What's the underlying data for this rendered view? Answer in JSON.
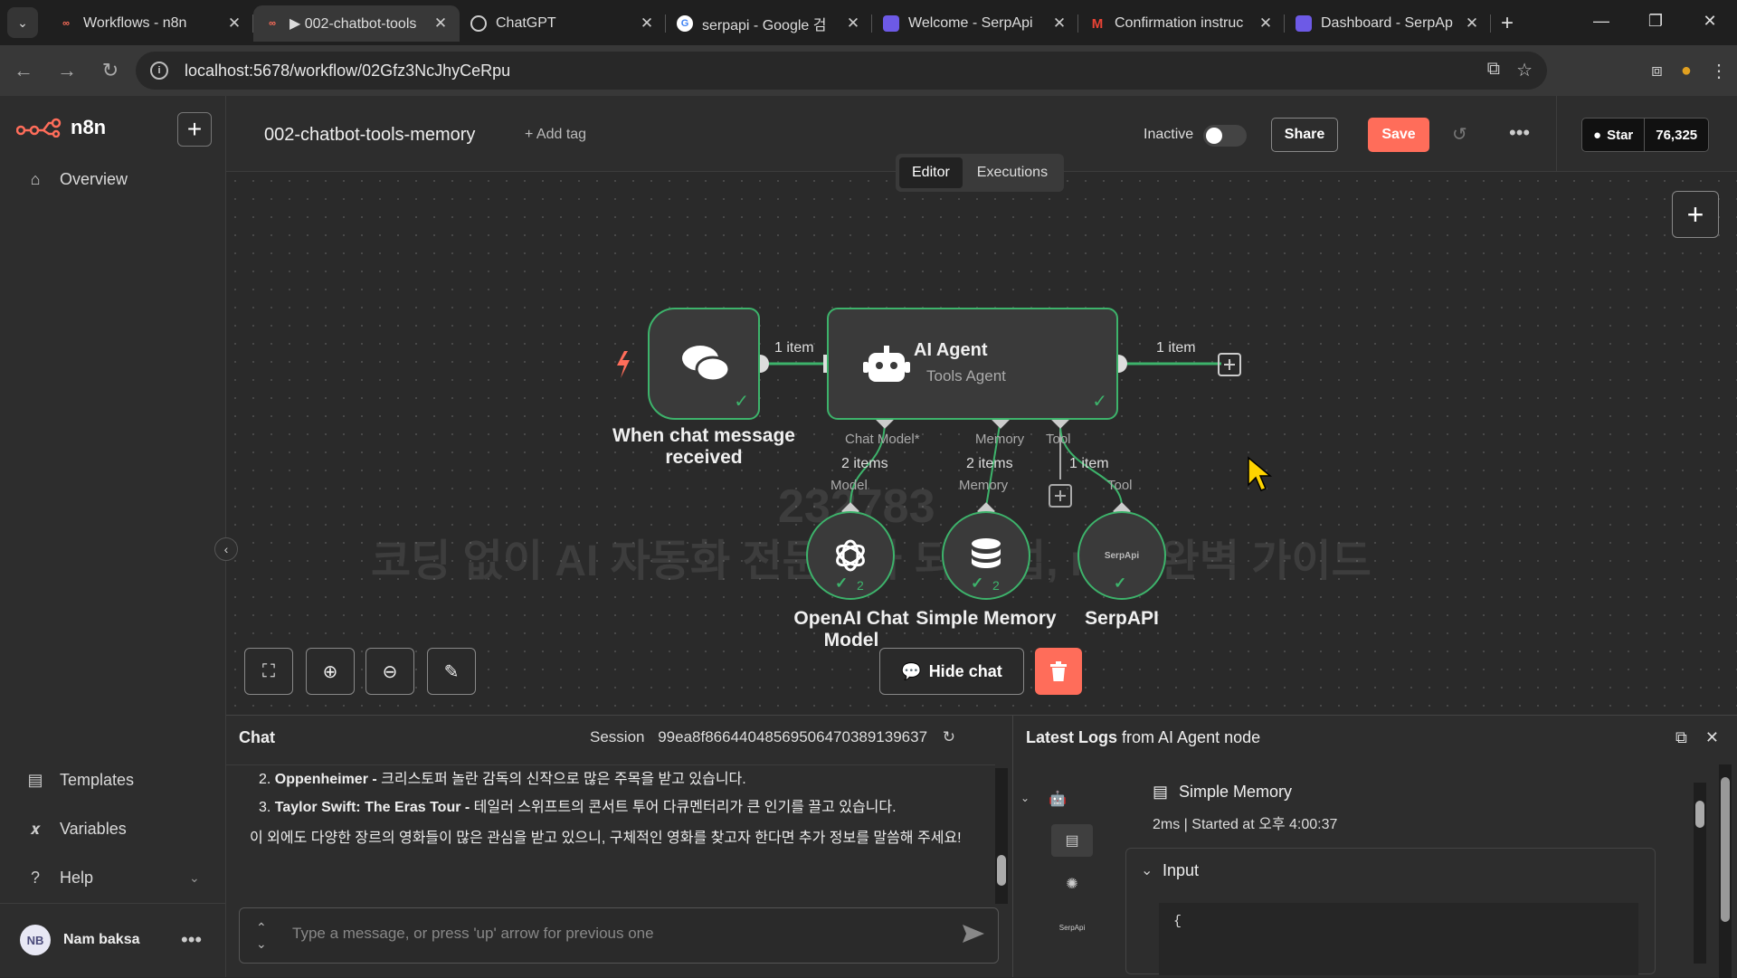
{
  "browser": {
    "tabs": [
      {
        "title": "Workflows - n8n",
        "favicon": "n8n-icon",
        "active": false
      },
      {
        "title": "▶ 002-chatbot-tools",
        "favicon": "n8n-icon",
        "active": true
      },
      {
        "title": "ChatGPT",
        "favicon": "chatgpt-icon",
        "active": false
      },
      {
        "title": "serpapi - Google 검",
        "favicon": "google-icon",
        "active": false
      },
      {
        "title": "Welcome - SerpApi",
        "favicon": "serpapi-icon",
        "active": false
      },
      {
        "title": "Confirmation instruc",
        "favicon": "gmail-icon",
        "active": false
      },
      {
        "title": "Dashboard - SerpAp",
        "favicon": "serpapi-icon",
        "active": false
      }
    ],
    "url": "localhost:5678/workflow/02Gfz3NcJhyCeRpu"
  },
  "sidebar": {
    "brand": "n8n",
    "items": [
      {
        "label": "Overview",
        "icon": "home-icon"
      },
      {
        "label": "Templates",
        "icon": "templates-icon"
      },
      {
        "label": "Variables",
        "icon": "variables-icon"
      },
      {
        "label": "Help",
        "icon": "help-icon"
      }
    ],
    "user": {
      "initials": "NB",
      "name": "Nam baksa"
    }
  },
  "header": {
    "workflow_name": "002-chatbot-tools-memory",
    "add_tag": "+ Add tag",
    "status": "Inactive",
    "share": "Share",
    "save": "Save",
    "github_star": "Star",
    "github_count": "76,325"
  },
  "tabs": {
    "editor": "Editor",
    "executions": "Executions"
  },
  "nodes": {
    "trigger": {
      "label": "When chat message received"
    },
    "agent": {
      "title": "AI Agent",
      "subtitle": "Tools Agent"
    },
    "openai": {
      "label": "OpenAI Chat Model",
      "badge": "2"
    },
    "memory": {
      "label": "Simple Memory",
      "badge": "2"
    },
    "serp": {
      "label": "SerpAPI",
      "icon_text": "SerpApi"
    }
  },
  "edges": {
    "trigger_agent": "1 item",
    "agent_out": "1 item",
    "model_items": "2 items",
    "memory_items": "2 items",
    "tool_items": "1 item",
    "port_chat_model": "Chat Model*",
    "port_memory": "Memory",
    "port_tool": "Tool",
    "sub_model": "Model",
    "sub_memory": "Memory",
    "sub_tool": "Tool"
  },
  "watermark": {
    "line1": "코딩 없이 AI 자동화 전문가가 되는 법, n8n 완벽 가이드",
    "line2": "232783"
  },
  "canvas_controls": {
    "hide_chat": "Hide chat"
  },
  "chat": {
    "title": "Chat",
    "session_label": "Session",
    "session_id": "99ea8f866440485695064703891396​37",
    "lines": [
      {
        "num": "2.",
        "bold": "Oppenheimer -",
        "text": " 크리스토퍼 놀란 감독의 신작으로 많은 주목을 받고 있습니다."
      },
      {
        "num": "3.",
        "bold": "Taylor Swift: The Eras Tour -",
        "text": " 테일러 스위프트의 콘서트 투어 다큐멘터리가 큰 인기를 끌고 있습니다."
      }
    ],
    "paragraph": "이 외에도 다양한 장르의 영화들이 많은 관심을 받고 있으니, 구체적인 영화를 찾고자 한다면 추가 정보를 말씀해 주세요!",
    "placeholder": "Type a message, or press 'up' arrow for previous one"
  },
  "logs": {
    "title_bold": "Latest Logs",
    "title_rest": " from AI Agent node",
    "node_name": "Simple Memory",
    "meta": "2ms | Started at 오후 4:00:37",
    "input_label": "Input",
    "code": "{"
  }
}
